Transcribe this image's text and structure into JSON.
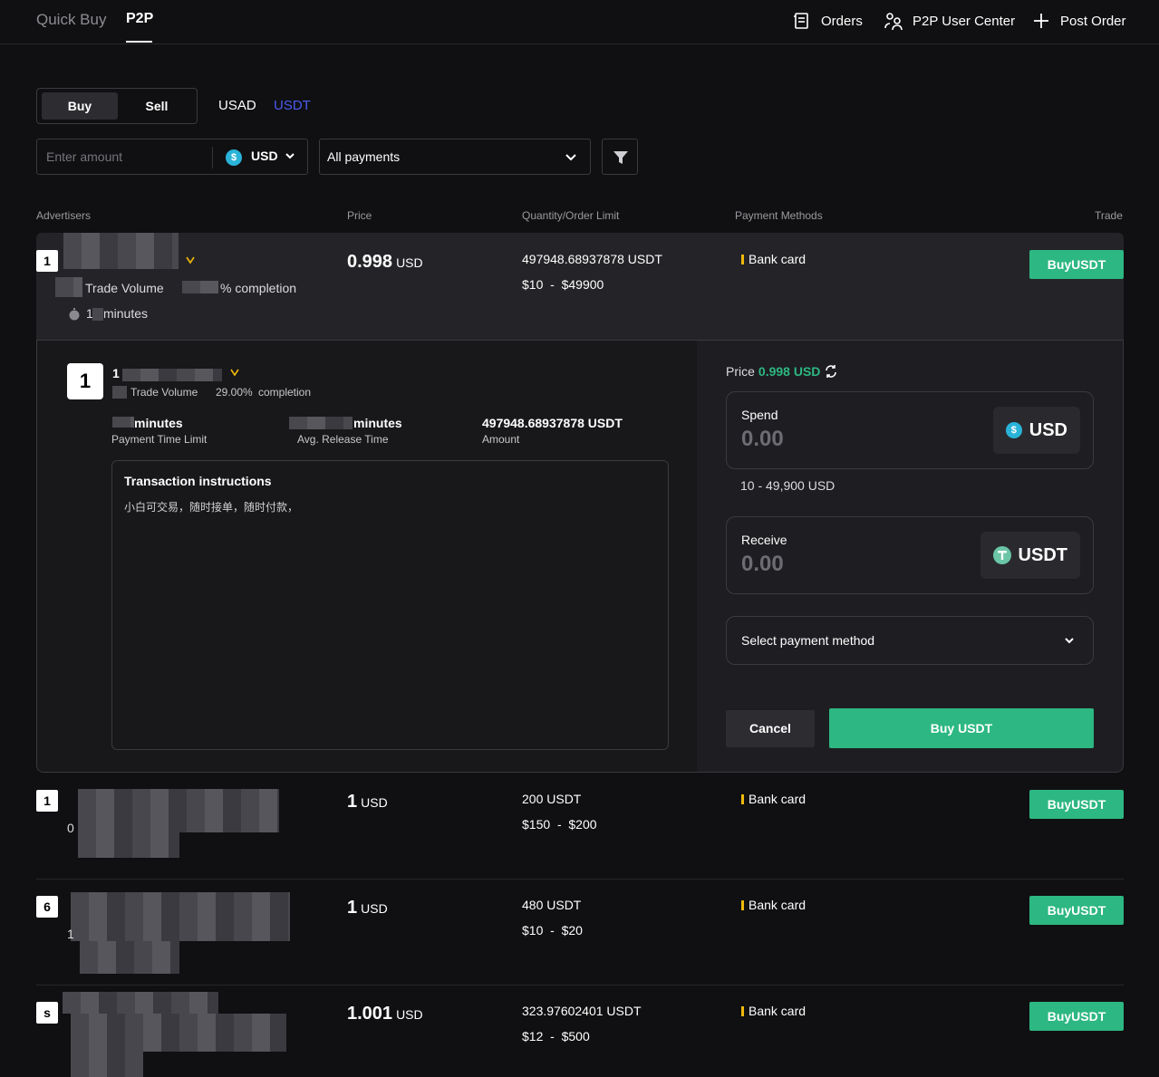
{
  "header": {
    "tabs": [
      {
        "label": "Quick Buy"
      },
      {
        "label": "P2P"
      }
    ],
    "nav": {
      "orders": "Orders",
      "user_center": "P2P User Center",
      "post_order": "Post Order"
    }
  },
  "controls": {
    "buy": "Buy",
    "sell": "Sell",
    "coins": [
      "USAD",
      "USDT"
    ],
    "amount_placeholder": "Enter amount",
    "currency": "USD",
    "currency_icon": "$",
    "payments": "All payments"
  },
  "table_header": {
    "advertisers": "Advertisers",
    "price": "Price",
    "quantity": "Quantity/Order Limit",
    "payment_methods": "Payment Methods",
    "trade": "Trade"
  },
  "rows": [
    {
      "rank": "1",
      "trade_volume": "Trade Volume",
      "completion": "% completion",
      "minutes_prefix": "1",
      "minutes": "minutes",
      "price": "0.998",
      "price_cur": "USD",
      "qty": "497948.68937878 USDT",
      "limit_min": "$10",
      "limit_sep": "-",
      "limit_max": "$49900",
      "payment": "Bank card",
      "button": "BuyUSDT"
    },
    {
      "rank": "1",
      "price": "1",
      "price_cur": "USD",
      "qty": "200 USDT",
      "limit_min": "$150",
      "limit_sep": "-",
      "limit_max": "$200",
      "payment": "Bank card",
      "button": "BuyUSDT",
      "side": "0"
    },
    {
      "rank": "6",
      "price": "1",
      "price_cur": "USD",
      "qty": "480 USDT",
      "limit_min": "$10",
      "limit_sep": "-",
      "limit_max": "$20",
      "payment": "Bank card",
      "button": "BuyUSDT",
      "side": "1"
    },
    {
      "rank": "s",
      "price": "1.001",
      "price_cur": "USD",
      "qty": "323.97602401 USDT",
      "limit_min": "$12",
      "limit_sep": "-",
      "limit_max": "$500",
      "payment": "Bank card",
      "button": "BuyUSDT"
    }
  ],
  "detail": {
    "rank": "1",
    "name_prefix": "1",
    "trade_volume": "Trade Volume",
    "completion_pct": "29.00%",
    "completion": "completion",
    "payment_limit_value": "minutes",
    "payment_limit_label": "Payment Time Limit",
    "release_value": "minutes",
    "release_label": "Avg. Release Time",
    "amount_value": "497948.68937878  USDT",
    "amount_label": "Amount",
    "instructions_title": "Transaction instructions",
    "instructions_body": "小白可交易，随时接单，随时付款，",
    "price_label": "Price",
    "price_value": "0.998 USD",
    "spend_label": "Spend",
    "spend_value": "0.00",
    "spend_currency": "USD",
    "range": "10 - 49,900 USD",
    "receive_label": "Receive",
    "receive_value": "0.00",
    "receive_currency": "USDT",
    "select_payment": "Select payment method",
    "cancel": "Cancel",
    "confirm": "Buy USDT"
  },
  "colors": {
    "accent": "#2db782",
    "link": "#4a5cf0",
    "bank_bar": "#f0b90b",
    "usd_icon": "#2ab3d8"
  }
}
